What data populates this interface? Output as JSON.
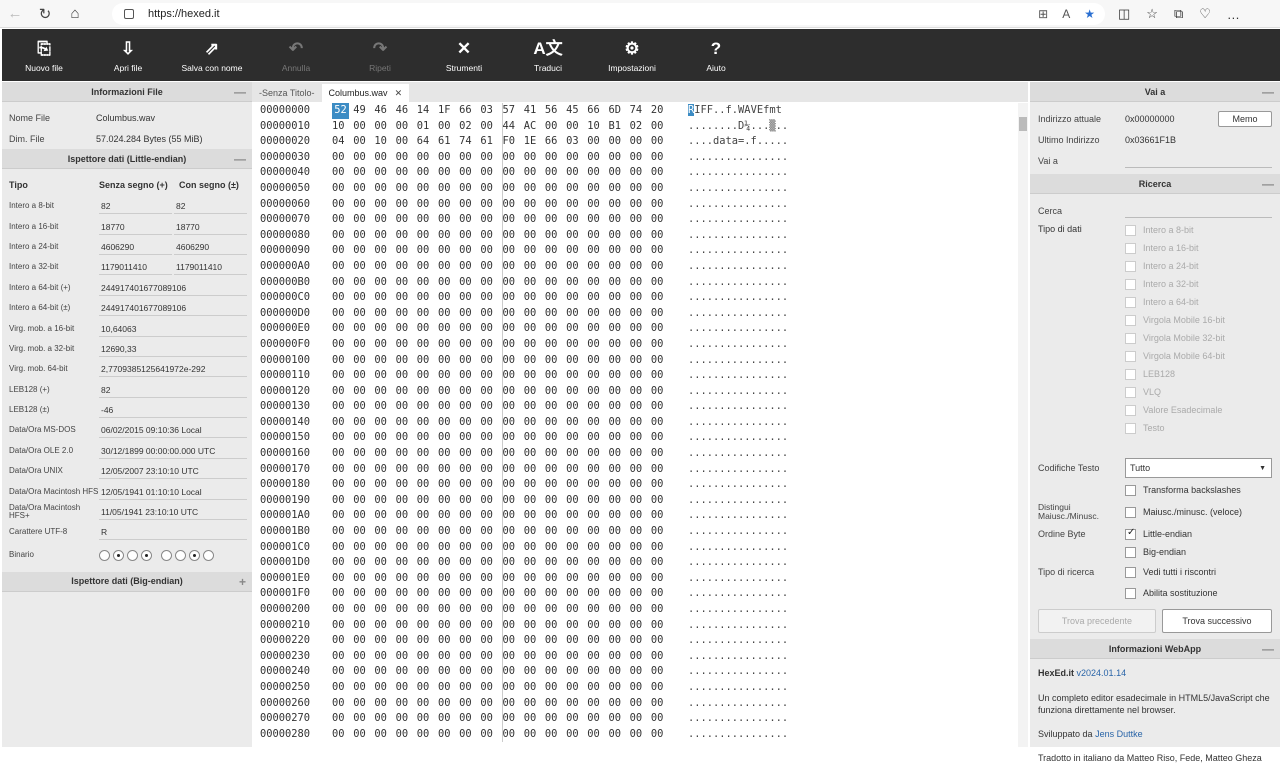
{
  "browser": {
    "url": "https://hexed.it"
  },
  "toolbar": [
    {
      "label": "Nuovo file",
      "icon": "new-file-icon",
      "glyph": "⎘",
      "enabled": true
    },
    {
      "label": "Apri file",
      "icon": "open-file-icon",
      "glyph": "⇩",
      "enabled": true
    },
    {
      "label": "Salva con nome",
      "icon": "save-as-icon",
      "glyph": "⇗",
      "enabled": true
    },
    {
      "label": "Annulla",
      "icon": "undo-icon",
      "glyph": "↶",
      "enabled": false
    },
    {
      "label": "Ripeti",
      "icon": "redo-icon",
      "glyph": "↷",
      "enabled": false
    },
    {
      "label": "Strumenti",
      "icon": "tools-icon",
      "glyph": "✕",
      "enabled": true
    },
    {
      "label": "Traduci",
      "icon": "translate-icon",
      "glyph": "A文",
      "enabled": true
    },
    {
      "label": "Impostazioni",
      "icon": "gear-icon",
      "glyph": "⚙",
      "enabled": true
    },
    {
      "label": "Aiuto",
      "icon": "help-icon",
      "glyph": "?",
      "enabled": true
    }
  ],
  "fileinfo": {
    "title": "Informazioni File",
    "name_label": "Nome File",
    "name_value": "Columbus.wav",
    "size_label": "Dim. File",
    "size_value": "57.024.284 Bytes (55 MiB)"
  },
  "inspector_le": {
    "title": "Ispettore dati (Little-endian)",
    "col_type": "Tipo",
    "col_unsigned": "Senza segno (+)",
    "col_signed": "Con segno (±)",
    "rows": [
      {
        "label": "Intero a 8-bit",
        "u": "82",
        "s": "82"
      },
      {
        "label": "Intero a 16-bit",
        "u": "18770",
        "s": "18770"
      },
      {
        "label": "Intero a 24-bit",
        "u": "4606290",
        "s": "4606290"
      },
      {
        "label": "Intero a 32-bit",
        "u": "1179011410",
        "s": "1179011410"
      },
      {
        "label": "Intero a 64-bit (+)",
        "w": "2449174016770891 06"
      },
      {
        "label": "Intero a 64-bit (±)",
        "w": "244917401677089106"
      },
      {
        "label": "Virg. mob. a 16-bit",
        "w": "10,64063"
      },
      {
        "label": "Virg. mob. a 32-bit",
        "w": "12690,33"
      },
      {
        "label": "Virg. mob. 64-bit",
        "w": "2,7709385125641972e-292"
      },
      {
        "label": "LEB128 (+)",
        "w": "82"
      },
      {
        "label": "LEB128 (±)",
        "w": "-46"
      },
      {
        "label": "Data/Ora MS-DOS",
        "w": "06/02/2015 09:10:36 Local"
      },
      {
        "label": "Data/Ora OLE 2.0",
        "w": "30/12/1899 00:00:00.000 UTC"
      },
      {
        "label": "Data/Ora UNIX",
        "w": "12/05/2007 23:10:10 UTC"
      },
      {
        "label": "Data/Ora Macintosh HFS",
        "w": "12/05/1941 01:10:10 Local"
      },
      {
        "label": "Data/Ora Macintosh HFS+",
        "w": "11/05/1941 23:10:10 UTC"
      },
      {
        "label": "Carattere UTF-8",
        "w": "R"
      }
    ],
    "binary_label": "Binario",
    "binary_bits": [
      0,
      1,
      0,
      1,
      0,
      0,
      1,
      0
    ]
  },
  "inspector_be": {
    "title": "Ispettore dati (Big-endian)"
  },
  "tabs": [
    {
      "label": "-Senza Titolo-",
      "active": false
    },
    {
      "label": "Columbus.wav",
      "active": true
    }
  ],
  "hex": {
    "rows": [
      {
        "a": "00000000",
        "b": [
          "52",
          "49",
          "46",
          "46",
          "14",
          "1F",
          "66",
          "03",
          "57",
          "41",
          "56",
          "45",
          "66",
          "6D",
          "74",
          "20"
        ],
        "t": "RIFF..f.WAVEfmt "
      },
      {
        "a": "00000010",
        "b": [
          "10",
          "00",
          "00",
          "00",
          "01",
          "00",
          "02",
          "00",
          "44",
          "AC",
          "00",
          "00",
          "10",
          "B1",
          "02",
          "00"
        ],
        "t": "........D¼...▒.."
      },
      {
        "a": "00000020",
        "b": [
          "04",
          "00",
          "10",
          "00",
          "64",
          "61",
          "74",
          "61",
          "F0",
          "1E",
          "66",
          "03",
          "00",
          "00",
          "00",
          "00"
        ],
        "t": "....data=.f....."
      }
    ],
    "zero_addresses": [
      "00000030",
      "00000040",
      "00000050",
      "00000060",
      "00000070",
      "00000080",
      "00000090",
      "000000A0",
      "000000B0",
      "000000C0",
      "000000D0",
      "000000E0",
      "000000F0",
      "00000100",
      "00000110",
      "00000120",
      "00000130",
      "00000140",
      "00000150",
      "00000160",
      "00000170",
      "00000180",
      "00000190",
      "000001A0",
      "000001B0",
      "000001C0",
      "000001D0",
      "000001E0",
      "000001F0",
      "00000200",
      "00000210",
      "00000220",
      "00000230",
      "00000240",
      "00000250",
      "00000260",
      "00000270",
      "00000280"
    ],
    "zero_byte": "00",
    "zero_ascii": "................"
  },
  "goto": {
    "title": "Vai a",
    "current_label": "Indirizzo attuale",
    "current_value": "0x00000000",
    "memo_label": "Memo",
    "last_label": "Ultimo Indirizzo",
    "last_value": "0x03661F1B",
    "goto_label": "Vai a"
  },
  "search": {
    "title": "Ricerca",
    "find_label": "Cerca",
    "datatype_label": "Tipo di dati",
    "datatypes": [
      "Intero a 8-bit",
      "Intero a 16-bit",
      "Intero a 24-bit",
      "Intero a 32-bit",
      "Intero a 64-bit",
      "Virgola Mobile 16-bit",
      "Virgola Mobile 32-bit",
      "Virgola Mobile 64-bit",
      "LEB128",
      "VLQ",
      "Valore Esadecimale",
      "Testo"
    ],
    "encoding_label": "Codifiche Testo",
    "encoding_value": "Tutto",
    "backslash_label": "Transforma backslashes",
    "case_label": "Distingui Maiusc./Minusc.",
    "case_option": "Maiusc./minusc. (veloce)",
    "order_label": "Ordine Byte",
    "little_label": "Little-endian",
    "big_label": "Big-endian",
    "searchtype_label": "Tipo di ricerca",
    "all_label": "Vedi tutti i riscontri",
    "replace_label": "Abilita sostituzione",
    "prev_label": "Trova precedente",
    "next_label": "Trova successivo"
  },
  "webapp": {
    "title": "Informazioni WebApp",
    "name": "HexEd.it",
    "version": "v2024.01.14",
    "desc": "Un completo editor esadecimale in HTML5/JavaScript che funziona direttamente nel browser.",
    "dev_prefix": "Sviluppato da",
    "dev_name": "Jens Duttke",
    "trans": "Tradotto in italiano da Matteo Riso, Fede, Matteo Gheza"
  }
}
